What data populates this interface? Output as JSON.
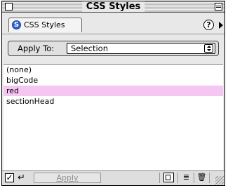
{
  "window": {
    "title": "CSS Styles"
  },
  "tab": {
    "label": "CSS Styles",
    "icon_glyph": "S"
  },
  "help": {
    "glyph": "?"
  },
  "apply_to": {
    "label": "Apply To:",
    "value": "Selection"
  },
  "styles": [
    {
      "label": "(none)"
    },
    {
      "label": "bigCode"
    },
    {
      "label": "red"
    },
    {
      "label": "sectionHead"
    }
  ],
  "selected_index": 2,
  "toolbar": {
    "checkbox_glyph": "✓",
    "return_glyph": "↵",
    "apply_label": "Apply",
    "edit_glyph": "≣",
    "delete_glyph": "🗑"
  },
  "colors": {
    "selection": "#f6c6f2",
    "tab_icon": "#2d5fcf"
  }
}
